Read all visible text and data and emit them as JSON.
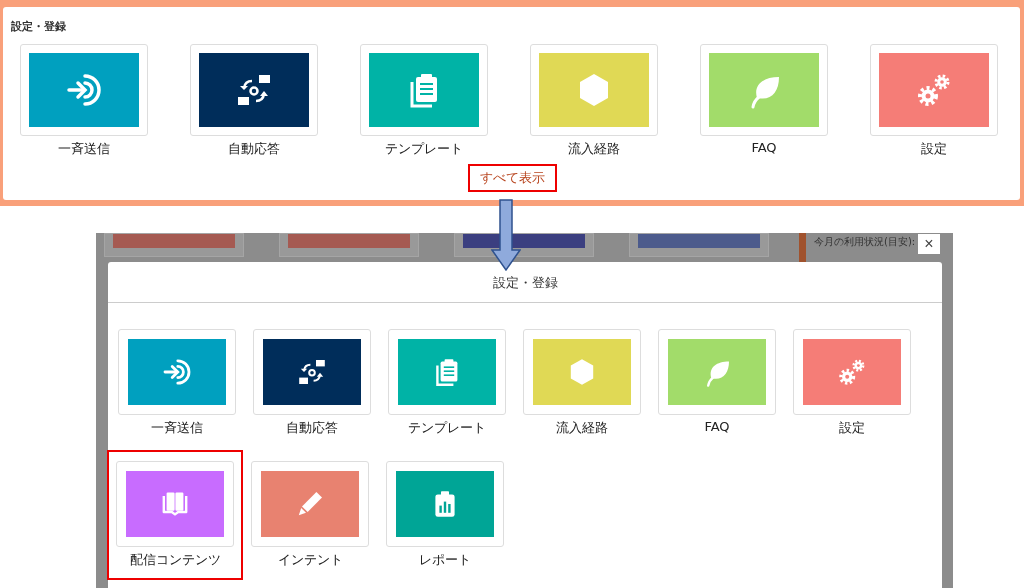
{
  "panel": {
    "title": "設定・登録",
    "items": [
      {
        "label": "一斉送信",
        "color": "#00a0bf"
      },
      {
        "label": "自動応答",
        "color": "#002d5a"
      },
      {
        "label": "テンプレート",
        "color": "#00b3a6"
      },
      {
        "label": "流入経路",
        "color": "#e0d955"
      },
      {
        "label": "FAQ",
        "color": "#a2dc6a"
      },
      {
        "label": "設定",
        "color": "#f57d77"
      }
    ],
    "show_all": {
      "label": "すべて表示",
      "highlighted": true
    }
  },
  "background": {
    "usage_label": "今月の利用状況(目安):"
  },
  "modal": {
    "title": "設定・登録",
    "close": "×",
    "items": [
      {
        "label": "一斉送信",
        "color": "#00a0bf",
        "highlighted": false
      },
      {
        "label": "自動応答",
        "color": "#002d5a",
        "highlighted": false
      },
      {
        "label": "テンプレート",
        "color": "#00b3a6",
        "highlighted": false
      },
      {
        "label": "流入経路",
        "color": "#e0d955",
        "highlighted": false
      },
      {
        "label": "FAQ",
        "color": "#a2dc6a",
        "highlighted": false
      },
      {
        "label": "設定",
        "color": "#f57d77",
        "highlighted": false
      },
      {
        "label": "配信コンテンツ",
        "color": "#c86cff",
        "highlighted": true
      },
      {
        "label": "インテント",
        "color": "#e88270",
        "highlighted": false
      },
      {
        "label": "レポート",
        "color": "#00a596",
        "highlighted": false
      }
    ]
  }
}
